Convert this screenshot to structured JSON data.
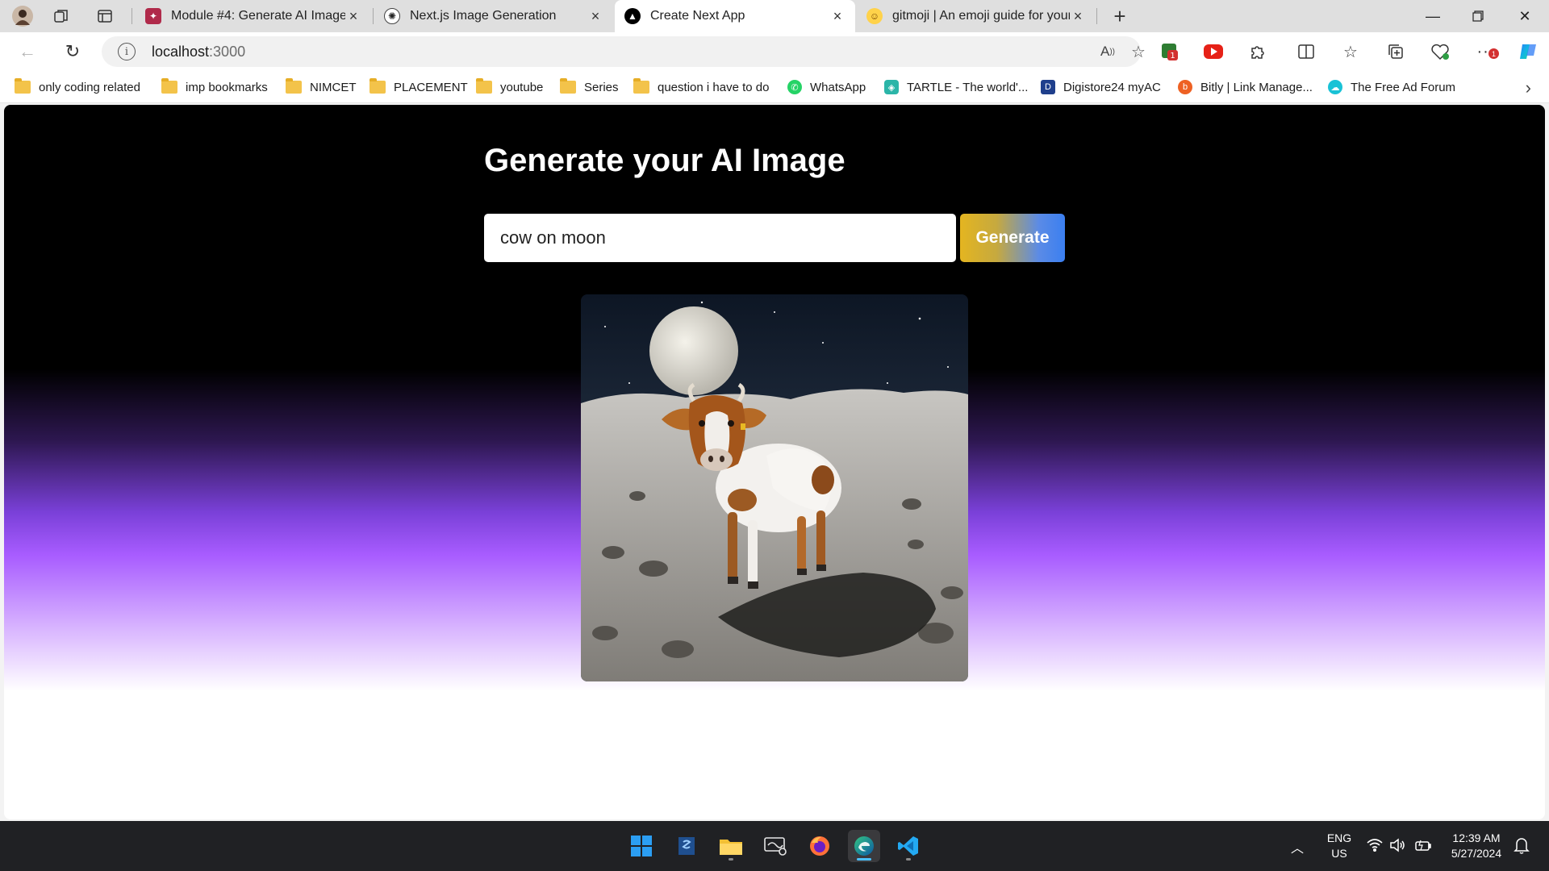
{
  "browser": {
    "tabs": [
      {
        "label": "Module #4: Generate AI Image",
        "favicon": "module-favicon",
        "active": false
      },
      {
        "label": "Next.js Image Generation",
        "favicon": "openai-favicon",
        "active": false
      },
      {
        "label": "Create Next App",
        "favicon": "nextjs-favicon",
        "active": true
      },
      {
        "label": "gitmoji | An emoji guide for your",
        "favicon": "gitmoji-favicon",
        "active": false
      }
    ],
    "address": {
      "host": "localhost",
      "port": ":3000"
    },
    "bookmarks": [
      {
        "label": "only coding  related",
        "type": "folder"
      },
      {
        "label": "imp bookmarks",
        "type": "folder"
      },
      {
        "label": "NIMCET",
        "type": "folder"
      },
      {
        "label": "PLACEMENT",
        "type": "folder"
      },
      {
        "label": "youtube",
        "type": "folder"
      },
      {
        "label": "Series",
        "type": "folder"
      },
      {
        "label": "question i have to do",
        "type": "folder"
      },
      {
        "label": "WhatsApp",
        "type": "site"
      },
      {
        "label": "TARTLE - The world'...",
        "type": "site"
      },
      {
        "label": "Digistore24 myAC",
        "type": "site"
      },
      {
        "label": "Bitly | Link Manage...",
        "type": "site"
      },
      {
        "label": "The Free Ad Forum",
        "type": "site"
      }
    ],
    "extensions": {
      "badge_count_1": "1",
      "badge_count_2": "1"
    }
  },
  "app": {
    "title": "Generate your AI Image",
    "prompt_value": "cow on moon",
    "generate_label": "Generate",
    "image_alt": "cow on moon"
  },
  "taskbar": {
    "apps": [
      "windows-start-icon",
      "app-icon",
      "file-explorer-icon",
      "monitor-app-icon",
      "firefox-icon",
      "edge-icon",
      "vscode-icon"
    ],
    "language_line1": "ENG",
    "language_line2": "US",
    "time": "12:39 AM",
    "date": "5/27/2024"
  },
  "colors": {
    "page_background_top": "#000000",
    "page_gradient_mid": "#a85cff",
    "page_background_bottom": "#ffffff",
    "button_gradient_start": "#e4b520",
    "button_gradient_end": "#3b7ff0"
  }
}
